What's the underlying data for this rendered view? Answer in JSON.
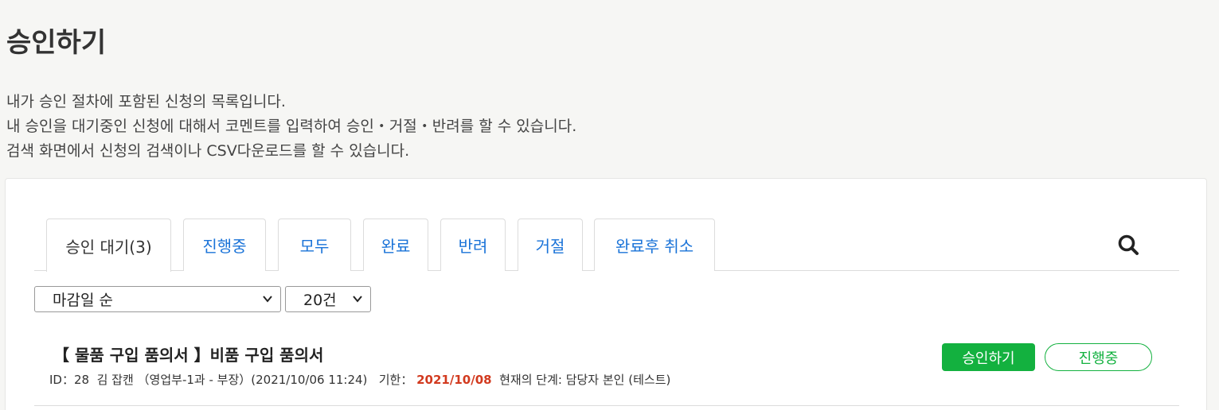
{
  "page": {
    "title": "승인하기",
    "description": [
      "내가 승인 절차에 포함된 신청의 목록입니다.",
      "내 승인을 대기중인 신청에 대해서 코멘트를 입력하여 승인・거절・반려를 할 수 있습니다.",
      "검색 화면에서 신청의 검색이나 CSV다운로드를 할 수 있습니다."
    ]
  },
  "tabs": [
    {
      "label": "승인 대기(3)",
      "active": true
    },
    {
      "label": "진행중",
      "active": false
    },
    {
      "label": "모두",
      "active": false
    },
    {
      "label": "완료",
      "active": false
    },
    {
      "label": "반려",
      "active": false
    },
    {
      "label": "거절",
      "active": false
    },
    {
      "label": "완료후 취소",
      "active": false
    }
  ],
  "search_icon": "search-icon",
  "filters": {
    "sort_value": "마감일 순",
    "count_value": "20건"
  },
  "items": [
    {
      "title": "【 물품 구입 품의서 】비품 구입 품의서",
      "id_text": "ID：28",
      "applicant": "김 잡캔 （영업부-1과 - 부장）(2021/10/06 11:24)",
      "deadline_label": "기한：",
      "deadline": "2021/10/08",
      "stage_text": "현재의 단계: 담당자 본인 (테스트)",
      "approve_label": "승인하기",
      "status_label": "진행중"
    }
  ],
  "colors": {
    "accent_blue": "#1a73d8",
    "approve_green": "#13b13f",
    "deadline_red": "#d23a1f"
  }
}
